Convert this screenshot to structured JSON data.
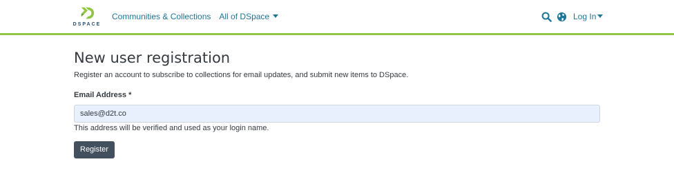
{
  "brand": {
    "logo_text": "DSPACE",
    "accent_color": "#92c642",
    "link_color": "#207698",
    "icon": "dspace-logo-icon"
  },
  "nav": {
    "communities": "Communities & Collections",
    "all_of_dspace": "All of DSpace"
  },
  "header_right": {
    "search_icon": "search-icon",
    "language_icon": "globe-icon",
    "login_label": "Log In"
  },
  "main": {
    "title": "New user registration",
    "intro": "Register an account to subscribe to collections for email updates, and submit new items to DSpace.",
    "email_label": "Email Address *",
    "email_value": "sales@d2t.co",
    "email_help": "This address will be verified and used as your login name.",
    "register_label": "Register",
    "button_color": "#43515f",
    "input_bg_color": "#e8f0fe"
  }
}
